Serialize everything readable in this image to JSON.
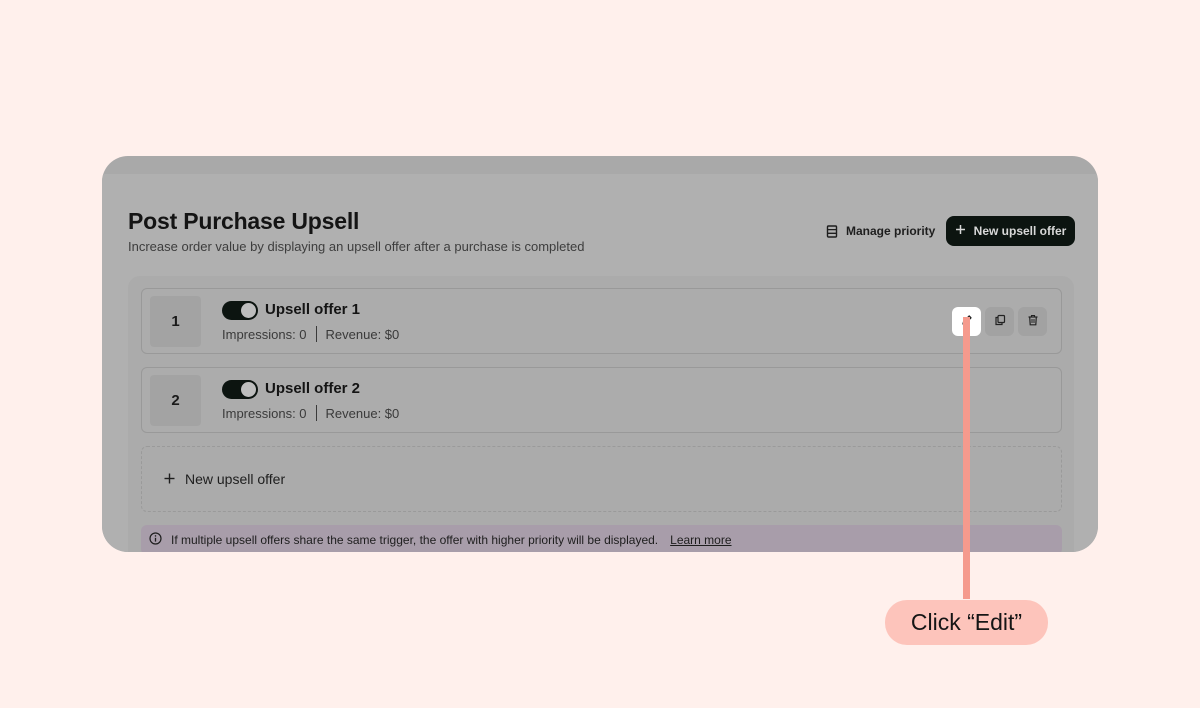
{
  "header": {
    "title": "Post Purchase Upsell",
    "subtitle": "Increase order value by displaying an upsell offer after a purchase is completed",
    "manage_priority_label": "Manage priority",
    "new_offer_label": "New upsell offer"
  },
  "offers": [
    {
      "priority": "1",
      "name": "Upsell offer 1",
      "enabled": true,
      "impressions": "Impressions: 0",
      "revenue": "Revenue: $0"
    },
    {
      "priority": "2",
      "name": "Upsell offer 2",
      "enabled": true,
      "impressions": "Impressions: 0",
      "revenue": "Revenue: $0"
    }
  ],
  "add_offer_label": "New upsell offer",
  "info_banner": {
    "text": "If multiple upsell offers share the same trigger, the offer with higher priority will be displayed.",
    "link_label": "Learn more"
  },
  "callout": {
    "label": "Click “Edit”"
  },
  "icons": {
    "manage_priority": "list-icon",
    "new_offer": "plus-icon",
    "edit": "pencil-icon",
    "duplicate": "copy-icon",
    "delete": "trash-icon",
    "info": "info-icon"
  },
  "colors": {
    "background": "#fff0ec",
    "primary_button": "#0c1410",
    "callout": "#f59a8d",
    "callout_bg": "#fdc4bb"
  }
}
